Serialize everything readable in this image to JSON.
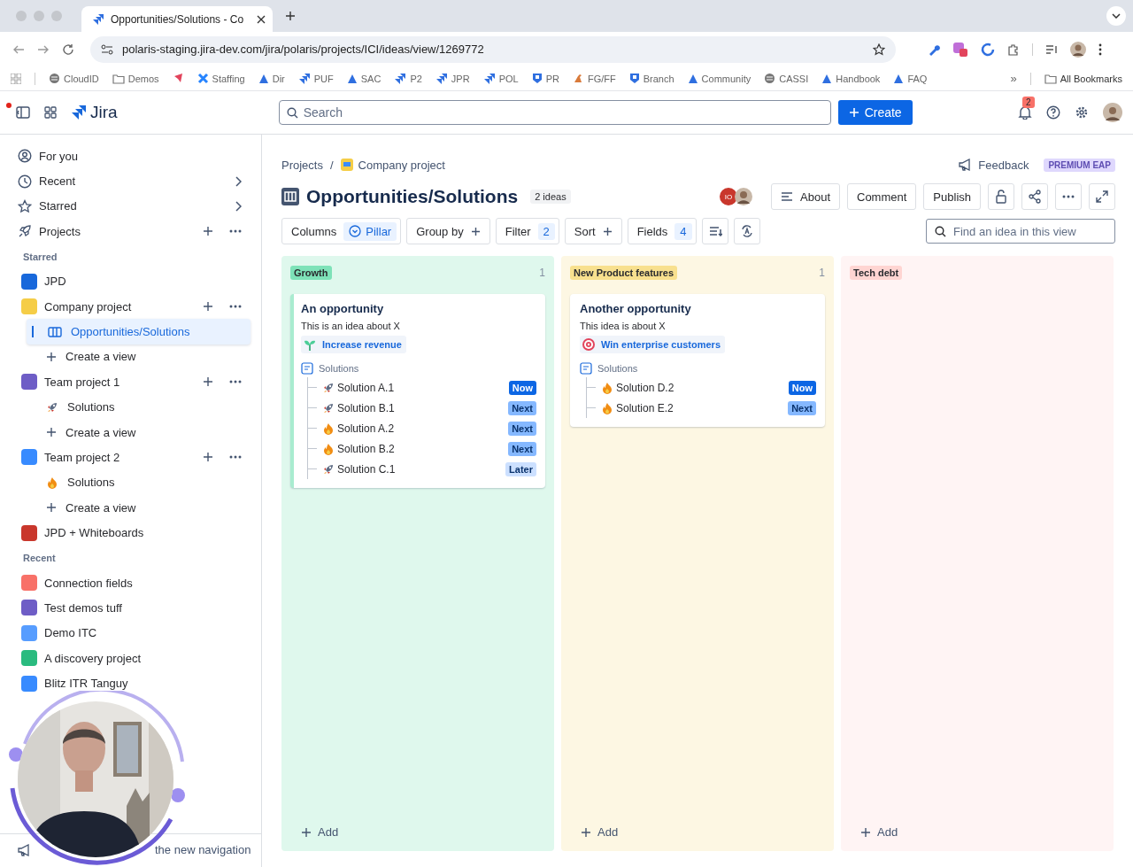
{
  "browser": {
    "tab_title": "Opportunities/Solutions - Co",
    "url": "polaris-staging.jira-dev.com/jira/polaris/projects/ICI/ideas/view/1269772",
    "bookmarks": [
      {
        "kind": "globe",
        "label": "CloudID"
      },
      {
        "kind": "folder",
        "label": "Demos"
      },
      {
        "kind": "mark"
      },
      {
        "kind": "cross",
        "label": "Staffing"
      },
      {
        "kind": "atlas",
        "label": "Dir"
      },
      {
        "kind": "jira",
        "label": "PUF"
      },
      {
        "kind": "atlas",
        "label": "SAC"
      },
      {
        "kind": "jira",
        "label": "P2"
      },
      {
        "kind": "jira",
        "label": "JPR"
      },
      {
        "kind": "jira",
        "label": "POL"
      },
      {
        "kind": "shield",
        "label": "PR"
      },
      {
        "kind": "bird",
        "label": "FG/FF"
      },
      {
        "kind": "shield",
        "label": "Branch"
      },
      {
        "kind": "atlas",
        "label": "Community"
      },
      {
        "kind": "globe",
        "label": "CASSI"
      },
      {
        "kind": "atlas",
        "label": "Handbook"
      },
      {
        "kind": "atlas",
        "label": "FAQ"
      }
    ],
    "more_bookmarks": "»",
    "all_bookmarks": "All Bookmarks"
  },
  "header": {
    "app_name": "Jira",
    "search": {
      "placeholder": "Search"
    },
    "create_label": "Create",
    "notification_count": "2"
  },
  "sidebar": {
    "nav": [
      {
        "label": "For you",
        "kind": "person",
        "selected": false
      },
      {
        "label": "Recent",
        "kind": "clock",
        "selected": false
      },
      {
        "label": "Starred",
        "kind": "star",
        "selected": false
      },
      {
        "label": "Projects",
        "kind": "rocket",
        "selected": false
      }
    ],
    "starred_heading": "Starred",
    "starred": [
      {
        "label": "JPD",
        "color": "#1868db",
        "selected": false
      },
      {
        "label": "Company project",
        "color": "#f5cd47",
        "selected": false,
        "children": [
          {
            "label": "Opportunities/Solutions",
            "kind": "board",
            "selected": true
          },
          {
            "label": "Create a view",
            "kind": "add",
            "selected": false
          }
        ]
      },
      {
        "label": "Team project 1",
        "color": "#6e5dc6",
        "selected": false,
        "children": [
          {
            "label": "Solutions",
            "kind": "rocket",
            "selected": false
          },
          {
            "label": "Create a view",
            "kind": "add",
            "selected": false
          }
        ]
      },
      {
        "label": "Team project 2",
        "color": "#388bff",
        "selected": false,
        "children": [
          {
            "label": "Solutions",
            "kind": "fire",
            "selected": false
          },
          {
            "label": "Create a view",
            "kind": "add",
            "selected": false
          }
        ]
      },
      {
        "label": "JPD + Whiteboards",
        "color": "#c9372c",
        "selected": false
      }
    ],
    "recent_heading": "Recent",
    "recent": [
      {
        "label": "Connection fields",
        "color": "#f87168",
        "selected": false
      },
      {
        "label": "Test demos tuff",
        "color": "#6e5dc6",
        "selected": false
      },
      {
        "label": "Demo ITC",
        "color": "#579dff",
        "selected": false
      },
      {
        "label": "A discovery project",
        "color": "#2abb7f",
        "selected": false
      },
      {
        "label": "Blitz ITR Tanguy",
        "color": "#388bff",
        "selected": false
      }
    ],
    "footer": "the new navigation"
  },
  "page": {
    "breadcrumbs": [
      "Projects",
      "Company project"
    ],
    "breadcrumb_separator": "/",
    "feedback": "Feedback",
    "plan_badge": "PREMIUM EAP",
    "title": "Opportunities/Solutions",
    "idea_count": "2 ideas",
    "avatar_initials": "IO",
    "actions": [
      "About",
      "Comment",
      "Publish"
    ],
    "toolbar": {
      "columns_label": "Columns",
      "columns_value": "Pillar",
      "group_by": "Group by",
      "filter": "Filter",
      "filter_count": "2",
      "sort": "Sort",
      "fields": "Fields",
      "fields_count": "4",
      "search": {
        "placeholder": "Find an idea in this view"
      }
    }
  },
  "board": {
    "columns": [
      {
        "label": "Growth",
        "count": "1",
        "color": "#7ee2b8",
        "cards": [
          {
            "title": "An opportunity",
            "description": "This is an idea about X",
            "accent": true,
            "pillar": {
              "kind": "sprout",
              "label": "Increase revenue"
            },
            "solutions_label": "Solutions",
            "solutions": [
              {
                "name": "Solution A.1",
                "kind": "rocket",
                "status": "Now",
                "color": "#0c66e4"
              },
              {
                "name": "Solution B.1",
                "kind": "rocket",
                "status": "Next",
                "color": "#85b8ff"
              },
              {
                "name": "Solution A.2",
                "kind": "fire",
                "status": "Next",
                "color": "#85b8ff"
              },
              {
                "name": "Solution B.2",
                "kind": "fire",
                "status": "Next",
                "color": "#85b8ff"
              },
              {
                "name": "Solution C.1",
                "kind": "rocket",
                "status": "Later",
                "color": "#cce0ff"
              }
            ]
          }
        ],
        "add_label": "Add"
      },
      {
        "label": "New Product features",
        "count": "1",
        "color": "#f8e08e",
        "cards": [
          {
            "title": "Another opportunity",
            "description": "This idea is about X",
            "accent": false,
            "pillar": {
              "kind": "target",
              "label": "Win enterprise customers"
            },
            "solutions_label": "Solutions",
            "solutions": [
              {
                "name": "Solution D.2",
                "kind": "fire",
                "status": "Now",
                "color": "#0c66e4"
              },
              {
                "name": "Solution E.2",
                "kind": "fire",
                "status": "Next",
                "color": "#85b8ff"
              }
            ]
          }
        ],
        "add_label": "Add"
      },
      {
        "label": "Tech debt",
        "color": "#ffd5d2",
        "add_label": "Add"
      }
    ]
  }
}
